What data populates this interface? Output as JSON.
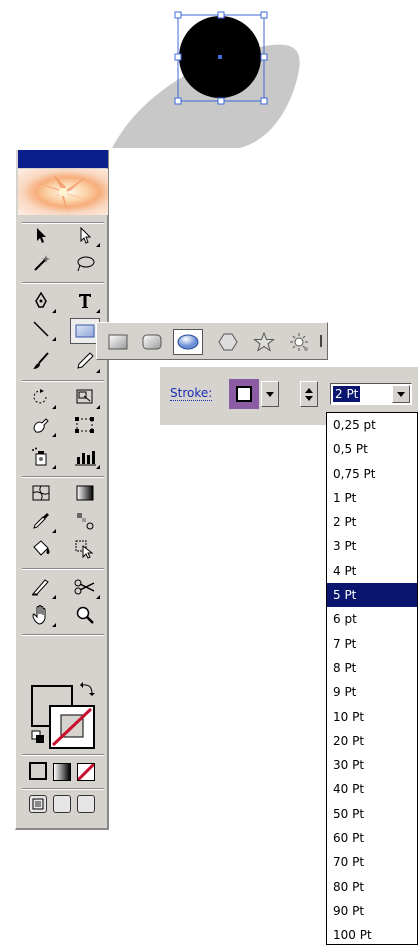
{
  "canvas": {
    "shape_fill": "#000000",
    "shadow_fill": "#c8c8c8",
    "selection_color": "#3c6ad8"
  },
  "toolbox": {
    "titlebar_color": "#0a1e8c",
    "background": "#d6d3ce",
    "tools": [
      "selection-tool",
      "direct-selection-tool",
      "magic-wand-tool",
      "lasso-tool",
      "pen-tool",
      "type-tool",
      "line-segment-tool",
      "rectangle-tool",
      "paintbrush-tool",
      "pencil-tool",
      "rotate-tool",
      "scale-tool",
      "warp-tool",
      "free-transform-tool",
      "symbol-sprayer-tool",
      "column-graph-tool",
      "mesh-tool",
      "gradient-tool",
      "eyedropper-tool",
      "blend-tool",
      "live-paint-bucket-tool",
      "live-paint-selection-tool",
      "slice-tool",
      "scissors-tool",
      "hand-tool",
      "zoom-tool"
    ]
  },
  "flyout": {
    "tools": [
      "rectangle-tool",
      "rounded-rectangle-tool",
      "ellipse-tool",
      "polygon-tool",
      "star-tool",
      "flare-tool"
    ],
    "active": "ellipse-tool"
  },
  "stroke_bar": {
    "label": "Stroke:",
    "swatch_color": "#8b5ba4",
    "weight_value": "2 Pt"
  },
  "weight_options": [
    "0,25 pt",
    "0,5 Pt",
    "0,75 Pt",
    "1 Pt",
    "2 Pt",
    "3 Pt",
    "4 Pt",
    "5 Pt",
    "6 pt",
    "7 Pt",
    "8 Pt",
    "9 Pt",
    "10 Pt",
    "20 Pt",
    "30 Pt",
    "40 Pt",
    "50 Pt",
    "60 Pt",
    "70 Pt",
    "80 Pt",
    "90 Pt",
    "100 Pt"
  ],
  "selected_weight": "5 Pt"
}
